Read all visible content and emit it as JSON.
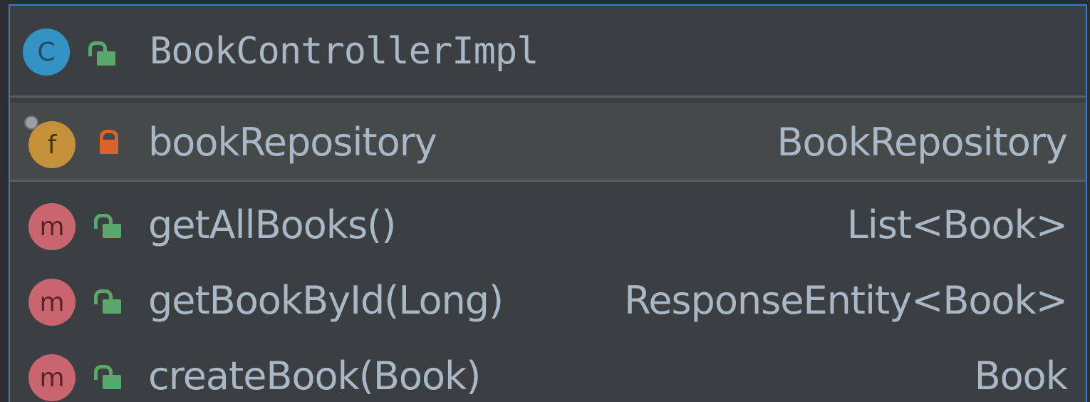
{
  "class": {
    "badge_letter": "C",
    "name": "BookControllerImpl",
    "visibility": "public"
  },
  "members": [
    {
      "kind_letter": "f",
      "visibility": "private",
      "name": "bookRepository",
      "type": "BookRepository"
    },
    {
      "kind_letter": "m",
      "visibility": "public",
      "name": "getAllBooks()",
      "type": "List<Book>"
    },
    {
      "kind_letter": "m",
      "visibility": "public",
      "name": "getBookById(Long)",
      "type": "ResponseEntity<Book>"
    },
    {
      "kind_letter": "m",
      "visibility": "public",
      "name": "createBook(Book)",
      "type": "Book"
    }
  ],
  "colors": {
    "panel_bg": "#3c3f41",
    "selected_row_bg": "#45494a",
    "border_accent": "#3d7cc9",
    "text": "#a9b7c6",
    "class_badge": "#3592c4",
    "field_badge": "#c4913a",
    "method_badge": "#c9656e",
    "public_lock": "#59a869",
    "private_lock": "#d9632b"
  },
  "icons": {
    "class": "class-icon",
    "field": "field-icon",
    "method": "method-icon",
    "public": "public-lock-open-icon",
    "private": "private-lock-icon",
    "pinned": "pin-icon"
  }
}
